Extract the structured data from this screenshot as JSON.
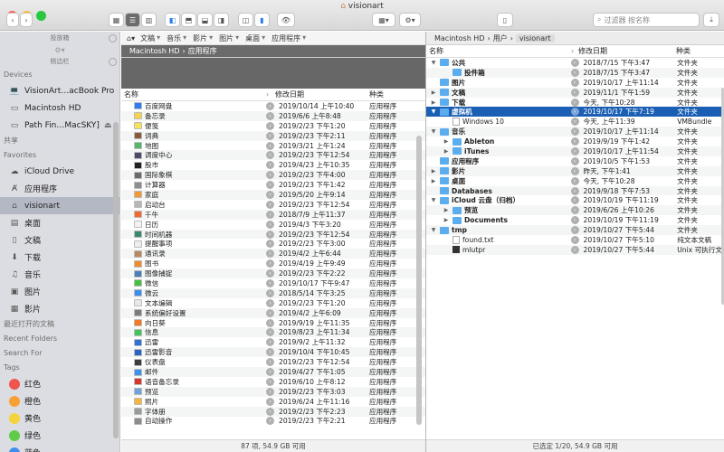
{
  "window": {
    "title": "visionart"
  },
  "toolbar": {
    "search_placeholder": "过滤器 按名称"
  },
  "sidebar": {
    "top_header": "投放箱",
    "sidebar_header": "侧边栏",
    "sections": {
      "devices": "Devices",
      "shared": "共享",
      "favorites": "Favorites",
      "recent_docs": "最近打开的文稿",
      "recent_folders": "Recent Folders",
      "search_for": "Search For",
      "tags": "Tags"
    },
    "devices": [
      "VisionArt…acBook Pro",
      "Macintosh HD",
      "Path Fin…MacSKY]"
    ],
    "favorites": [
      "iCloud Drive",
      "应用程序",
      "visionart",
      "桌面",
      "文稿",
      "下载",
      "音乐",
      "图片",
      "影片"
    ],
    "tags": [
      {
        "label": "红色",
        "color": "#f0544f"
      },
      {
        "label": "橙色",
        "color": "#f7a035"
      },
      {
        "label": "黄色",
        "color": "#f5d33c"
      },
      {
        "label": "绿色",
        "color": "#5fcb47"
      },
      {
        "label": "蓝色",
        "color": "#3d8ff0"
      }
    ]
  },
  "left_pane": {
    "crumb_menus": [
      "文稿",
      "音乐",
      "影片",
      "图片",
      "桌面",
      "应用程序"
    ],
    "path": [
      "Macintosh HD",
      "应用程序"
    ],
    "columns": {
      "name": "名称",
      "date": "修改日期",
      "kind": "种类"
    },
    "rows": [
      {
        "name": "百度网盘",
        "date": "2019/10/14 上午10:40",
        "kind": "应用程序",
        "color": "#2f7cf6"
      },
      {
        "name": "备忘录",
        "date": "2019/6/6 上午8:48",
        "kind": "应用程序",
        "color": "#f5d44b"
      },
      {
        "name": "便笺",
        "date": "2019/2/23 下午1:20",
        "kind": "应用程序",
        "color": "#f6e35a"
      },
      {
        "name": "词典",
        "date": "2019/2/23 下午2:11",
        "kind": "应用程序",
        "color": "#8a5a3c"
      },
      {
        "name": "地图",
        "date": "2019/3/21 上午1:24",
        "kind": "应用程序",
        "color": "#55b86a"
      },
      {
        "name": "调度中心",
        "date": "2019/2/23 下午12:54",
        "kind": "应用程序",
        "color": "#4a4a6a"
      },
      {
        "name": "股市",
        "date": "2019/4/23 上午10:35",
        "kind": "应用程序",
        "color": "#222222"
      },
      {
        "name": "国际象棋",
        "date": "2019/2/23 下午4:00",
        "kind": "应用程序",
        "color": "#6b6b6b"
      },
      {
        "name": "计算器",
        "date": "2019/2/23 下午1:42",
        "kind": "应用程序",
        "color": "#8e8e8e"
      },
      {
        "name": "家庭",
        "date": "2019/5/20 上午9:14",
        "kind": "应用程序",
        "color": "#f29a33"
      },
      {
        "name": "启动台",
        "date": "2019/2/23 下午12:54",
        "kind": "应用程序",
        "color": "#b7b7b7"
      },
      {
        "name": "千牛",
        "date": "2018/7/9 上午11:37",
        "kind": "应用程序",
        "color": "#ef6a2c"
      },
      {
        "name": "日历",
        "date": "2019/4/3 下午3:20",
        "kind": "应用程序",
        "color": "#f2f2f2"
      },
      {
        "name": "时间机器",
        "date": "2019/2/23 下午12:54",
        "kind": "应用程序",
        "color": "#3a8b6e"
      },
      {
        "name": "提醒事项",
        "date": "2019/2/23 下午3:00",
        "kind": "应用程序",
        "color": "#eeeeee"
      },
      {
        "name": "通讯录",
        "date": "2019/4/2 上午6:44",
        "kind": "应用程序",
        "color": "#b48b5c"
      },
      {
        "name": "图书",
        "date": "2019/4/19 上午9:49",
        "kind": "应用程序",
        "color": "#f08a2b"
      },
      {
        "name": "图像捕捉",
        "date": "2019/2/23 下午2:22",
        "kind": "应用程序",
        "color": "#4b7fb7"
      },
      {
        "name": "微信",
        "date": "2019/10/17 下午9:47",
        "kind": "应用程序",
        "color": "#44c23f"
      },
      {
        "name": "微云",
        "date": "2018/5/14 下午3:25",
        "kind": "应用程序",
        "color": "#3b8ef0"
      },
      {
        "name": "文本编辑",
        "date": "2019/2/23 下午1:20",
        "kind": "应用程序",
        "color": "#e8e8e8"
      },
      {
        "name": "系统偏好设置",
        "date": "2019/4/2 上午6:09",
        "kind": "应用程序",
        "color": "#7c7c7c"
      },
      {
        "name": "向日葵",
        "date": "2019/9/19 上午11:35",
        "kind": "应用程序",
        "color": "#f27a22"
      },
      {
        "name": "信息",
        "date": "2019/8/23 上午11:34",
        "kind": "应用程序",
        "color": "#44c45d"
      },
      {
        "name": "迅雷",
        "date": "2019/9/2 上午11:32",
        "kind": "应用程序",
        "color": "#2f72d6"
      },
      {
        "name": "迅雷影音",
        "date": "2019/10/4 下午10:45",
        "kind": "应用程序",
        "color": "#2a64c5"
      },
      {
        "name": "仪表盘",
        "date": "2019/2/23 下午12:54",
        "kind": "应用程序",
        "color": "#3d3d3d"
      },
      {
        "name": "邮件",
        "date": "2019/4/27 下午1:05",
        "kind": "应用程序",
        "color": "#3d92ef"
      },
      {
        "name": "语音备忘录",
        "date": "2019/6/10 上午8:12",
        "kind": "应用程序",
        "color": "#d9352f"
      },
      {
        "name": "预览",
        "date": "2019/2/23 下午3:03",
        "kind": "应用程序",
        "color": "#6fa2d8"
      },
      {
        "name": "照片",
        "date": "2019/6/24 上午11:16",
        "kind": "应用程序",
        "color": "#f4b73b"
      },
      {
        "name": "字体册",
        "date": "2019/2/23 下午2:23",
        "kind": "应用程序",
        "color": "#9a9a9a"
      },
      {
        "name": "自动操作",
        "date": "2019/2/23 下午2:21",
        "kind": "应用程序",
        "color": "#8d8d8d"
      }
    ],
    "status": "87 项, 54.9 GB 可用"
  },
  "right_pane": {
    "path": [
      "Macintosh HD",
      "用户",
      "visionart"
    ],
    "columns": {
      "name": "名称",
      "date": "修改日期",
      "kind": "种类"
    },
    "rows": [
      {
        "name": "公共",
        "date": "2018/7/15 下午3:47",
        "kind": "文件夹",
        "icon": "folder",
        "depth": 0,
        "disc": "open",
        "bold": true
      },
      {
        "name": "投件箱",
        "date": "2018/7/15 下午3:47",
        "kind": "文件夹",
        "icon": "folder",
        "depth": 1,
        "disc": "",
        "bold": true
      },
      {
        "name": "图片",
        "date": "2019/10/17 上午11:14",
        "kind": "文件夹",
        "icon": "folder",
        "depth": 0,
        "disc": "",
        "bold": true
      },
      {
        "name": "文稿",
        "date": "2019/11/1 下午1:59",
        "kind": "文件夹",
        "icon": "folder",
        "depth": 0,
        "disc": "closed",
        "bold": true
      },
      {
        "name": "下载",
        "date": "今天, 下午10:28",
        "kind": "文件夹",
        "icon": "folder",
        "depth": 0,
        "disc": "closed",
        "bold": true
      },
      {
        "name": "虚拟机",
        "date": "2019/10/17 下午7:19",
        "kind": "文件夹",
        "icon": "folder",
        "depth": 0,
        "disc": "open",
        "bold": true,
        "selected": true
      },
      {
        "name": "Windows 10",
        "date": "今天, 上午11:39",
        "kind": "VMBundle",
        "icon": "doc",
        "depth": 1,
        "disc": "",
        "bold": false
      },
      {
        "name": "音乐",
        "date": "2019/10/17 上午11:14",
        "kind": "文件夹",
        "icon": "folder",
        "depth": 0,
        "disc": "open",
        "bold": true
      },
      {
        "name": "Ableton",
        "date": "2019/9/19 下午1:42",
        "kind": "文件夹",
        "icon": "folder",
        "depth": 1,
        "disc": "closed",
        "bold": true
      },
      {
        "name": "iTunes",
        "date": "2019/10/17 上午11:54",
        "kind": "文件夹",
        "icon": "folder",
        "depth": 1,
        "disc": "closed",
        "bold": true
      },
      {
        "name": "应用程序",
        "date": "2019/10/5 下午1:53",
        "kind": "文件夹",
        "icon": "folder",
        "depth": 0,
        "disc": "",
        "bold": true
      },
      {
        "name": "影片",
        "date": "昨天, 下午1:41",
        "kind": "文件夹",
        "icon": "folder",
        "depth": 0,
        "disc": "closed",
        "bold": true
      },
      {
        "name": "桌面",
        "date": "今天, 下午10:28",
        "kind": "文件夹",
        "icon": "folder",
        "depth": 0,
        "disc": "closed",
        "bold": true
      },
      {
        "name": "Databases",
        "date": "2019/9/18 下午7:53",
        "kind": "文件夹",
        "icon": "folder",
        "depth": 0,
        "disc": "",
        "bold": true
      },
      {
        "name": "iCloud 云盘（归档）",
        "date": "2019/10/19 下午11:19",
        "kind": "文件夹",
        "icon": "folder",
        "depth": 0,
        "disc": "open",
        "bold": true
      },
      {
        "name": "预览",
        "date": "2019/6/26 上午10:26",
        "kind": "文件夹",
        "icon": "folder",
        "depth": 1,
        "disc": "closed",
        "bold": true
      },
      {
        "name": "Documents",
        "date": "2019/10/19 下午11:19",
        "kind": "文件夹",
        "icon": "folder",
        "depth": 1,
        "disc": "closed",
        "bold": true
      },
      {
        "name": "tmp",
        "date": "2019/10/27 下午5:44",
        "kind": "文件夹",
        "icon": "folder",
        "depth": 0,
        "disc": "open",
        "bold": true
      },
      {
        "name": "found.txt",
        "date": "2019/10/27 下午5:10",
        "kind": "纯文本文稿",
        "icon": "doc",
        "depth": 1,
        "disc": "",
        "bold": false
      },
      {
        "name": "mlutpr",
        "date": "2019/10/27 下午5:44",
        "kind": "Unix 可执行文",
        "icon": "term",
        "depth": 1,
        "disc": "",
        "bold": false
      }
    ],
    "status": "已选定 1/20, 54.9 GB 可用"
  },
  "colors": {
    "selection": "#1a5fb4",
    "folder": "#5cadee",
    "sidebar_bg": "#dcdde2"
  }
}
